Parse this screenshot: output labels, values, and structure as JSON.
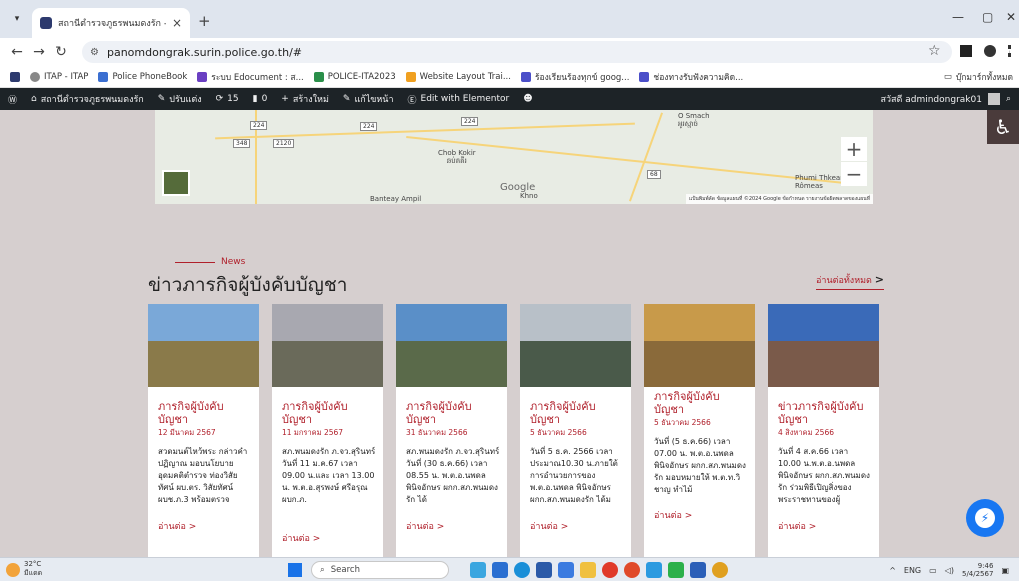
{
  "browser": {
    "tab_title": "สถานีตำรวจภูธรพนมดงรัก - Phanom",
    "url": "panomdongrak.surin.police.go.th/#",
    "bookmarks": [
      {
        "label": "ITAP - ITAP",
        "color": "#888888"
      },
      {
        "label": "Police PhoneBook",
        "color": "#3b6fd1"
      },
      {
        "label": "ระบบ Edocument : ส...",
        "color": "#6a3fc2"
      },
      {
        "label": "POLICE-ITA2023",
        "color": "#2a8f4a"
      },
      {
        "label": "Website Layout Trai...",
        "color": "#f0a020"
      },
      {
        "label": "ร้องเรียนร้องทุกข์ goog...",
        "color": "#4b4fc9"
      },
      {
        "label": "ช่องทางรับฟังความคิด...",
        "color": "#4b4fc9"
      }
    ],
    "bookmarks_folder": "บุ๊กมาร์กทั้งหมด"
  },
  "wpbar": {
    "site_name": "สถานีตำรวจภูธรพนมดงรัก",
    "customize": "ปรับแต่ง",
    "updates": "15",
    "comments": "0",
    "new": "สร้างใหม่",
    "edit": "แก้ไขหน้า",
    "elementor": "Edit with Elementor",
    "greeting": "สวัสดี admindongrak01"
  },
  "map": {
    "routes": [
      "224",
      "348",
      "2120",
      "224",
      "224",
      "68"
    ],
    "labels": {
      "smach": "O Smach",
      "smach_th": "អូរស្មាច់",
      "chob": "Chob Kokir",
      "chob_km": "ឆប់គគីរ",
      "khno": "Khno",
      "thkeam": "Phumi Thkeam",
      "thkeam2": "Rômeas",
      "bantey": "Banteay Ampil"
    },
    "google": "Google",
    "attribution": "แป้นพิมพ์ลัด  ข้อมูลแผนที่ ©2024 Google  ข้อกำหนด  รายงานข้อผิดพลาดของแผนที่",
    "zoom_in": "+",
    "zoom_out": "−"
  },
  "news": {
    "kicker": "News",
    "title": "ข่าวภารกิจผู้บังคับบัญชา",
    "read_all": "อ่านต่อทั้งหมด",
    "read_more": "อ่านต่อ >",
    "cards": [
      {
        "title": "ภารกิจผู้บังคับบัญชา",
        "date": "12 มีนาคม 2567",
        "excerpt": "สวดมนต์ไหว้พระ กล่าวคำปฏิญาณ มอบนโยบาย อุดมคติตำรวจ ท่องวิสัยทัศน์ ผบ.ตร. วิสัยทัศน์ ผบช.ภ.3 พร้อมตรวจ",
        "sky": "#7aa8d8",
        "ground": "#8a7a4a"
      },
      {
        "title": "ภารกิจผู้บังคับบัญชา",
        "date": "11 มกราคม 2567",
        "excerpt": "สภ.พนมดงรัก ภ.จว.สุรินทร์วันที่ 11 ม.ค.67 เวลา 09.00 น.และ เวลา 13.00 น. พ.ต.อ.สุรพงษ์ ศรีอรุณ ผบก.ภ.",
        "sky": "#a8a8b0",
        "ground": "#6a6a5a"
      },
      {
        "title": "ภารกิจผู้บังคับบัญชา",
        "date": "31 ธันวาคม 2566",
        "excerpt": "สภ.พนมดงรัก ภ.จว.สุรินทร์วันที่ (30 ธ.ค.66) เวลา 08.55 น. พ.ต.อ.นพดล พินิจอักษร ผกก.สภ.พนมดงรัก ได้",
        "sky": "#5a8fc8",
        "ground": "#5a6a4a"
      },
      {
        "title": "ภารกิจผู้บังคับบัญชา",
        "date": "5 ธันวาคม 2566",
        "excerpt": "วันที่ 5 ธ.ค. 2566 เวลาประมาณ10.30 น.ภายใต้การอำนวยการของ พ.ต.อ.นพดล พินิจอักษร ผกก.สภ.พนมดงรัก ได้ม",
        "sky": "#b8c0c8",
        "ground": "#4a5a4a"
      },
      {
        "title": "ภารกิจผู้บังคับบัญชา",
        "date": "5 ธันวาคม 2566",
        "excerpt": "วันที่ (5 ธ.ค.66) เวลา 07.00 น. พ.ต.อ.นพดล พินิจอักษร ผกก.สภ.พนมดงรัก มอบหมายให้ พ.ต.ท.วิชาญ ทำไม้",
        "sky": "#c89a4a",
        "ground": "#8a6a3a"
      },
      {
        "title": "ข่าวภารกิจผู้บังคับบัญชา",
        "date": "4 สิงหาคม 2566",
        "excerpt": "วันที่ 4 ส.ค.66 เวลา 10.00 น.พ.ต.อ.นพดล พินิจอักษร ผกก.สภ.พนมดงรัก ร่วมพิธีเปิญสิ่งของ พระราชทานของผู้",
        "sky": "#3a6ab8",
        "ground": "#7a5a4a"
      }
    ]
  },
  "taskbar": {
    "temp": "32°C",
    "weather": "มีแดด",
    "search": "Search",
    "lang": "ENG",
    "time": "9:46",
    "date": "5/4/2567"
  },
  "colors": {
    "accent": "#b0202b",
    "section_bg": "#d6cfcf",
    "wpbar": "#1d2327"
  }
}
